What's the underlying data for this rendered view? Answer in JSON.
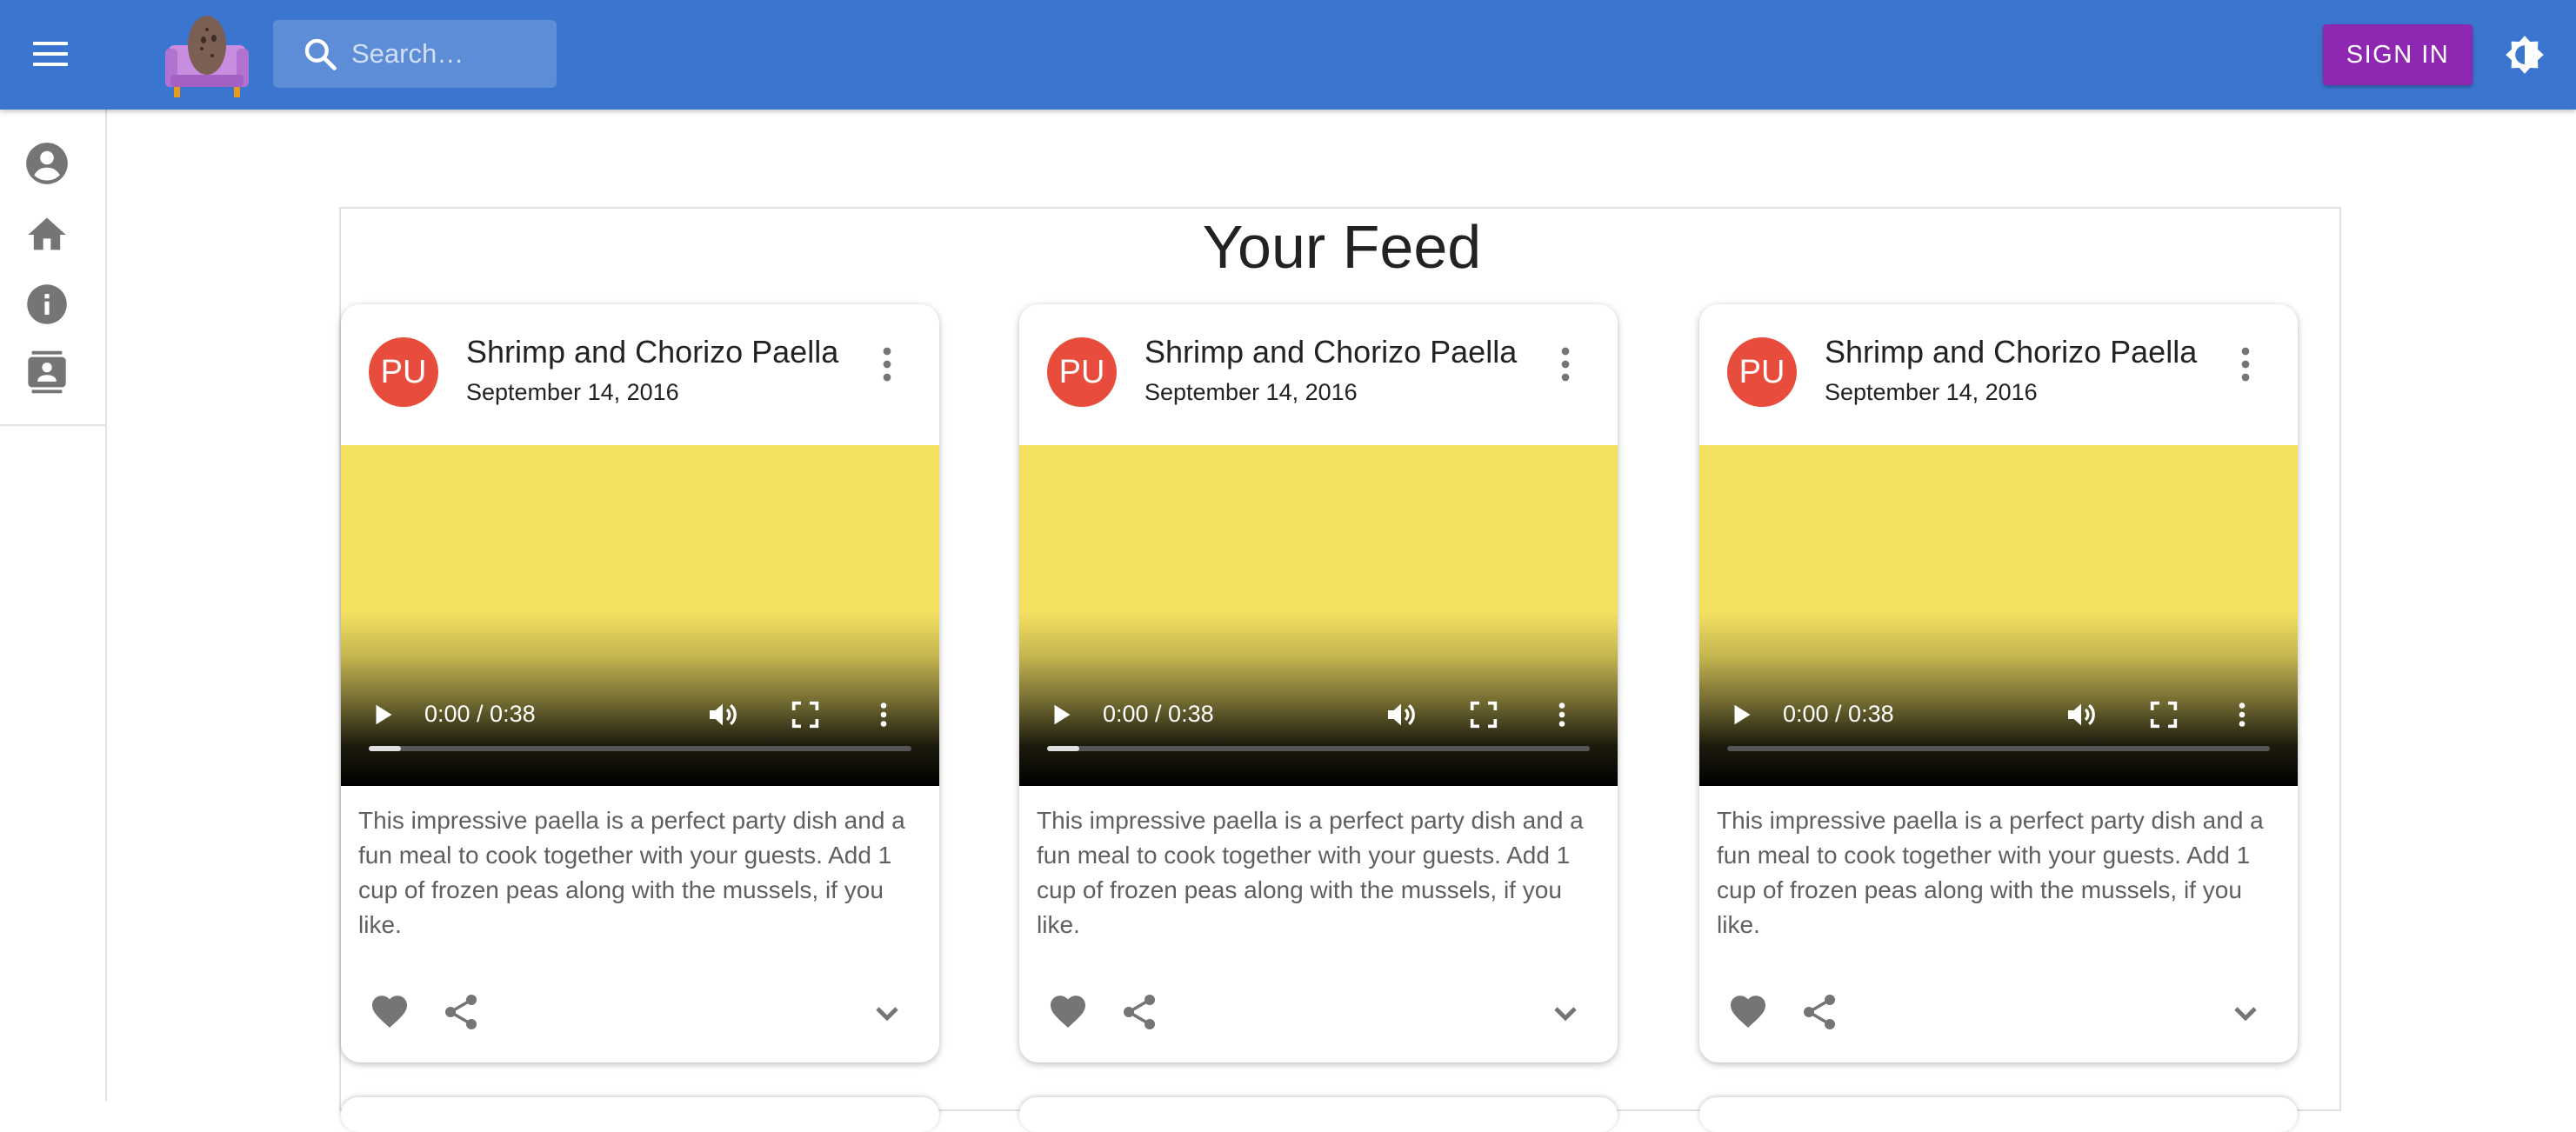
{
  "appbar": {
    "background": "#3a75cf",
    "menu_icon": "menu-icon",
    "logo": "potato-on-couch-logo",
    "search": {
      "placeholder": "Search…",
      "value": ""
    },
    "sign_in_label": "SIGN IN",
    "sign_in_color": "#8e28b3",
    "theme_icon": "brightness-icon"
  },
  "siderail": {
    "items": [
      {
        "name": "account",
        "icon": "account-circle-icon"
      },
      {
        "name": "home",
        "icon": "home-icon"
      },
      {
        "name": "about",
        "icon": "info-icon"
      },
      {
        "name": "contacts",
        "icon": "contact-card-icon"
      }
    ]
  },
  "feed": {
    "title": "Your Feed",
    "cards": [
      {
        "avatar": "PU",
        "title": "Shrimp and Chorizo Paella",
        "date": "September 14, 2016",
        "video": {
          "time": "0:00 / 0:38",
          "buffered_fraction": 0.06
        },
        "description": "This impressive paella is a perfect party dish and a fun meal to cook together with your guests. Add 1 cup of frozen peas along with the mussels, if you like."
      },
      {
        "avatar": "PU",
        "title": "Shrimp and Chorizo Paella",
        "date": "September 14, 2016",
        "video": {
          "time": "0:00 / 0:38",
          "buffered_fraction": 0.06
        },
        "description": "This impressive paella is a perfect party dish and a fun meal to cook together with your guests. Add 1 cup of frozen peas along with the mussels, if you like."
      },
      {
        "avatar": "PU",
        "title": "Shrimp and Chorizo Paella",
        "date": "September 14, 2016",
        "video": {
          "time": "0:00 / 0:38",
          "buffered_fraction": 0.0
        },
        "description": "This impressive paella is a perfect party dish and a fun meal to cook together with your guests. Add 1 cup of frozen peas along with the mussels, if you like."
      }
    ]
  },
  "colors": {
    "avatar": "#e74c3c",
    "video_poster": "#f4e162",
    "icon_gray": "#757575"
  }
}
